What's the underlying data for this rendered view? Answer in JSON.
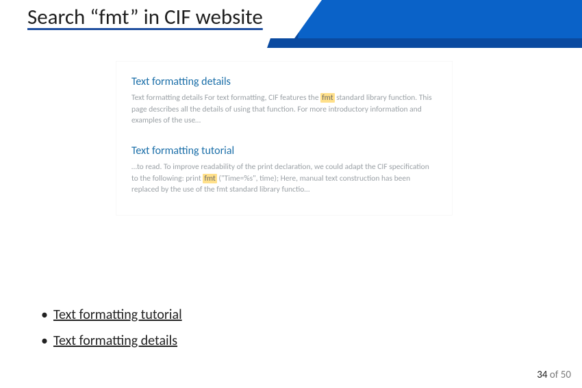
{
  "title": "Search “fmt” in CIF website",
  "results": [
    {
      "title": "Text formatting details",
      "pre": "Text formatting details For text formatting, CIF features the ",
      "hl": "fmt",
      "post": " standard library function. This page describes all the details of using that function. For more introductory information and examples of the use…"
    },
    {
      "title": "Text formatting tutorial",
      "pre": "…to read. To improve readability of the print declaration, we could adapt the CIF specification to the following: print ",
      "hl": "fmt",
      "post": " (\"Time=%s\", time); Here, manual text construction has been replaced by the use of the fmt standard library functio…"
    }
  ],
  "bullets": [
    "Text formatting tutorial",
    "Text formatting details"
  ],
  "page": {
    "current": "34",
    "sep": " of ",
    "total": "50"
  },
  "colors": {
    "blue": "#0a62c8",
    "blueDark": "#0a4aa0"
  }
}
